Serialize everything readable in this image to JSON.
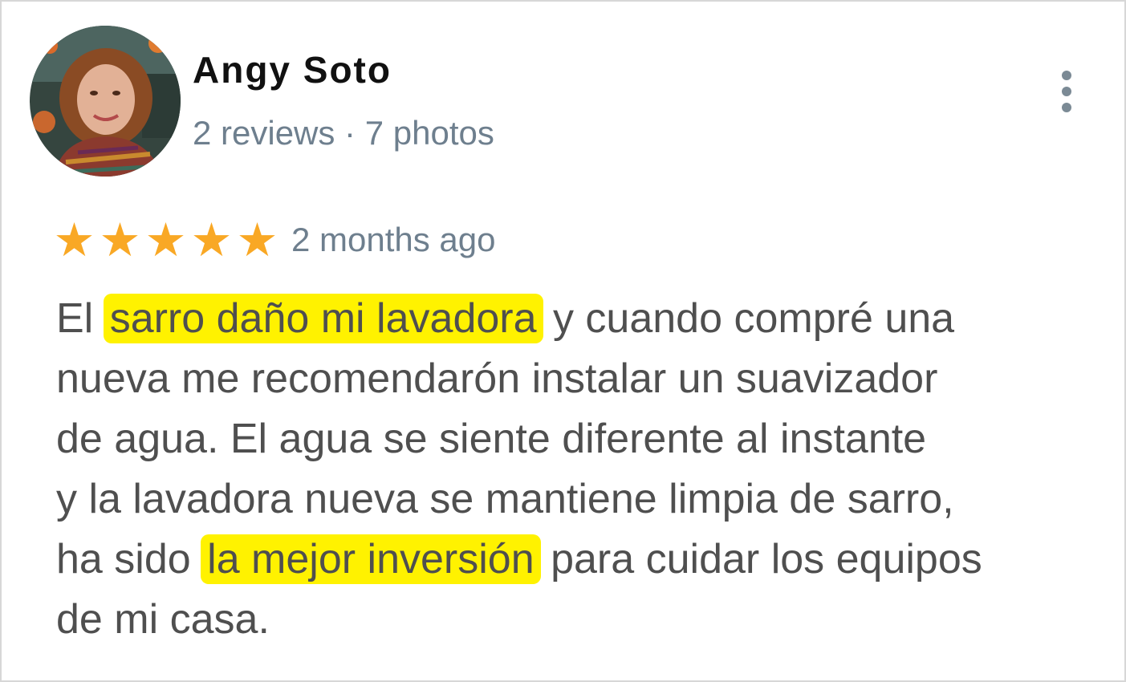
{
  "review": {
    "author": {
      "name": "Angy Soto",
      "meta": "2 reviews · 7 photos"
    },
    "menu_icon": "more-vertical-icon",
    "rating": {
      "value": 5,
      "max": 5,
      "star_glyph": "★",
      "star_color": "#f9a825"
    },
    "time": "2 months ago",
    "highlight_color": "#fff200",
    "text_lines": [
      [
        {
          "text": "El "
        },
        {
          "text": "sarro daño mi lavadora",
          "highlight": true
        },
        {
          "text": " y cuando compré una"
        }
      ],
      [
        {
          "text": "nueva me recomendarón instalar un suavizador"
        }
      ],
      [
        {
          "text": "de agua. El agua se siente diferente al instante"
        }
      ],
      [
        {
          "text": "y la lavadora nueva se mantiene limpia de sarro,"
        }
      ],
      [
        {
          "text": "ha sido "
        },
        {
          "text": "la mejor inversión",
          "highlight": true
        },
        {
          "text": " para cuidar los equipos"
        }
      ],
      [
        {
          "text": "de mi casa."
        }
      ]
    ]
  }
}
